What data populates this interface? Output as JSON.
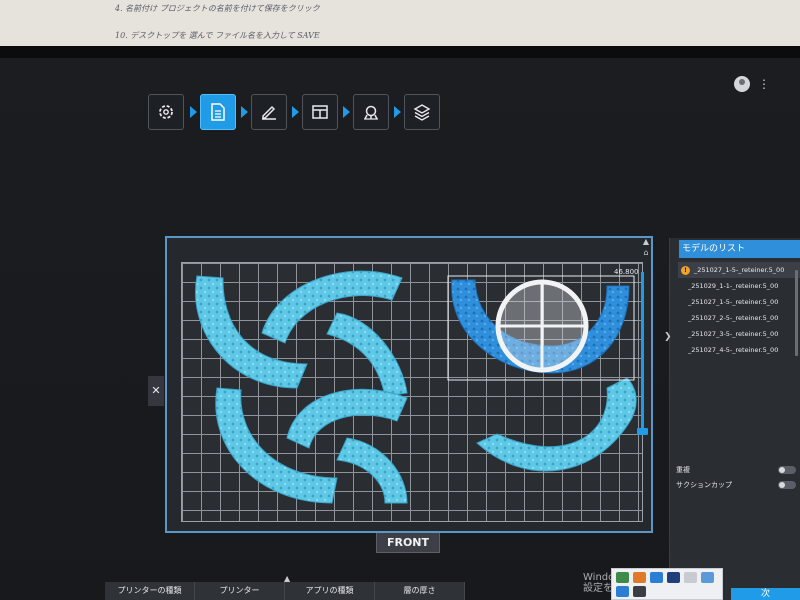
{
  "paper_notes": {
    "line1": "4.   名前付け   プロジェクトの名前を付けて保存をクリック",
    "line2": "10.   デスクトップを 選んで   ファイル名を入力して   SAVE"
  },
  "toolbar": {
    "steps": [
      {
        "icon": "gear-icon",
        "active": false
      },
      {
        "icon": "document-icon",
        "active": true
      },
      {
        "icon": "pen-icon",
        "active": false
      },
      {
        "icon": "layout-icon",
        "active": false
      },
      {
        "icon": "support-icon",
        "active": false
      },
      {
        "icon": "layers-icon",
        "active": false
      }
    ]
  },
  "viewport": {
    "z_value": "46.800",
    "front_label": "FRONT",
    "close_label": "✕"
  },
  "model_panel": {
    "title": "モデルのリスト",
    "items": [
      "_251027_1-5-_reteiner.5_00",
      "_251029_1-1-_reteiner.5_00",
      "_251027_1-5-_reteiner.5_00",
      "_251027_2-5-_reteiner.5_00",
      "_251027_3-5-_reteiner.5_00",
      "_251027_4-5-_reteiner.5_00"
    ],
    "toggles": [
      {
        "label": "重複"
      },
      {
        "label": "サクションカップ"
      }
    ]
  },
  "bottom_tabs": [
    "プリンターの種類",
    "プリンター",
    "アプリの種類",
    "層の厚さ"
  ],
  "windows": {
    "watermark_line1": "Windo",
    "watermark_line2": "設定を開",
    "next_label": "次"
  },
  "colors": {
    "accent": "#1f9be8",
    "model": "#5ec8e6",
    "selected_model": "#2f8fdb"
  }
}
